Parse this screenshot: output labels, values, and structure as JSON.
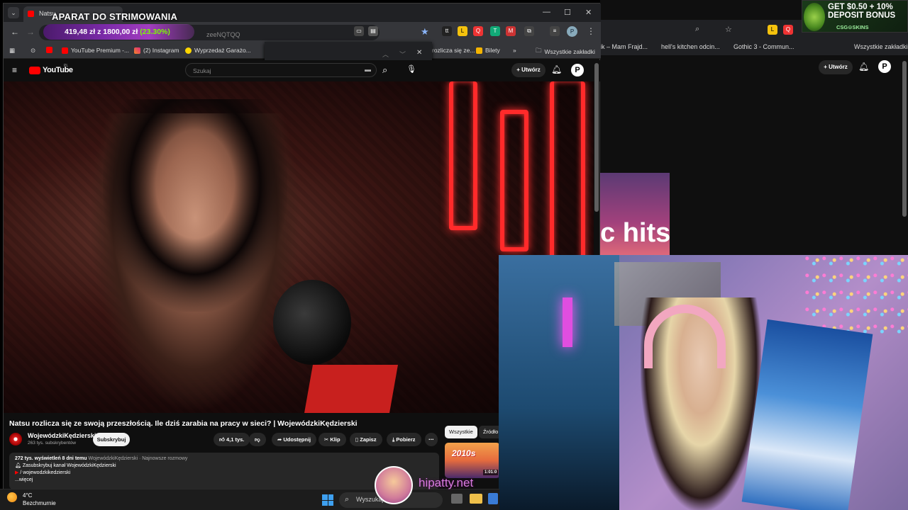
{
  "overlay": {
    "camera_title": "APARAT DO STRIMOWANIA",
    "donation_amount": "419,48 zł",
    "donation_goal": "z 1800,00 zł",
    "donation_percent": "(23.30%)",
    "brand": "hipatty.net"
  },
  "promo": {
    "line1": "GET $0.50 + 10%",
    "line2": "DEPOSIT BONUS",
    "line3": "CSG⊙SKINS"
  },
  "browser": {
    "tab_title": "Natsu",
    "url_tail": "zeeNQTQQ",
    "bookmarks": [
      "YouTube Premium -...",
      "(2) Instagram",
      "Wyprzedaż Garażo...",
      "rozlicza się ze...",
      "Bilety",
      "Wszystkie zakładki"
    ]
  },
  "bg_browser": {
    "bookmarks": [
      "ik – Mam Frajd...",
      "hell's kitchen odcin...",
      "Gothic 3 - Commun...",
      "Wszystkie zakładki"
    ],
    "create_label": "Utwórz",
    "thumb_text": "c hits"
  },
  "youtube": {
    "logo": "YouTube",
    "logo_region": "PL",
    "search_placeholder": "Szukaj",
    "create_label": "Utwórz",
    "video_title": "Natsu rozlicza się ze swoją przeszłością. Ile dziś zarabia na pracy w sieci? | WojewódzkiKędzierski",
    "channel_name": "WojewódzkiKędzierski",
    "subscribers": "263 tys. subskrybentów",
    "subscribe_label": "Subskrybuj",
    "likes": "4,1 tys.",
    "share_label": "Udostępnij",
    "clip_label": "Klip",
    "save_label": "Zapisz",
    "download_label": "Pobierz",
    "views": "272 tys. wyświetleń  8 dni temu",
    "desc_tags": "WojewódzkiKędzierski · Najnowsze rozmowy",
    "desc_line1": "Zasubskrybuj kanał WojewódzkiKędzierski",
    "desc_line2": "/ wojewodzkikedzierski",
    "more_label": "...więcej",
    "chip_all": "Wszystkie",
    "chip_source": "Źródło",
    "side_thumb_text": "2010s",
    "side_thumb_time": "1:01:0"
  },
  "taskbar": {
    "temperature": "4°C",
    "weather": "Bezchmurnie",
    "search_placeholder": "Wyszukaj"
  }
}
